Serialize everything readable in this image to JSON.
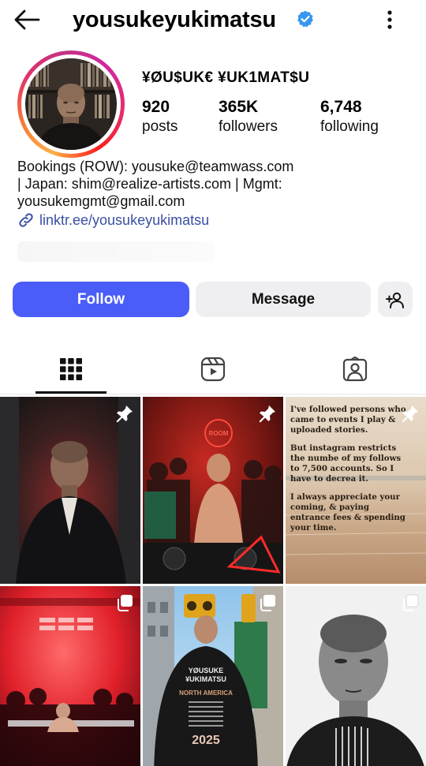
{
  "header": {
    "username": "yousukeyukimatsu",
    "back_icon": "arrow-left-icon",
    "verified_icon": "verified-badge-icon",
    "more_icon": "more-vertical-icon"
  },
  "profile": {
    "display_name": "¥ØU$UK€ ¥UK1MAT$U",
    "stats": [
      {
        "number": "920",
        "label": "posts"
      },
      {
        "number": "365K",
        "label": "followers"
      },
      {
        "number": "6,748",
        "label": "following"
      }
    ],
    "bio_lines": [
      "Bookings (ROW): yousuke@teamwass.com",
      "| Japan: shim@realize-artists.com | Mgmt:",
      "yousukemgmt@gmail.com"
    ],
    "link": "linktr.ee/yousukeyukimatsu"
  },
  "actions": {
    "follow_label": "Follow",
    "message_label": "Message",
    "add_user_icon": "add-user-icon"
  },
  "tabs": [
    {
      "icon": "grid-icon",
      "active": true
    },
    {
      "icon": "reels-icon",
      "active": false
    },
    {
      "icon": "tagged-icon",
      "active": false
    }
  ],
  "posts": {
    "text_post": {
      "paragraphs": [
        "I've followed persons who came to events I play & uploaded stories.",
        "But instagram restricts the numbe of my follows to 7,500 accounts. So I have to decrea it.",
        "I always appreciate your coming, & paying entrance fees & spending your time."
      ]
    },
    "shirt_text": {
      "line1": "YØUSUKE",
      "line2": "¥UKIMATSU",
      "line3": "NORTH AMERICA",
      "year": "2025"
    },
    "sign_text": "ROOM"
  },
  "colors": {
    "accent": "#4a5df9",
    "verified": "#3897f0",
    "link": "#3b4fa3",
    "secondary_button": "#efeff2"
  }
}
